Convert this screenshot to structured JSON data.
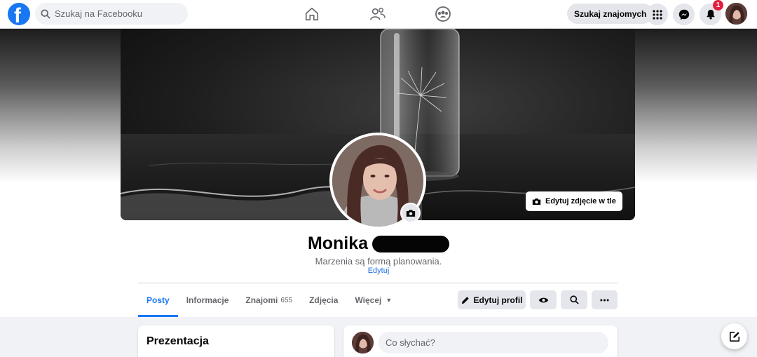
{
  "topbar": {
    "search_placeholder": "Szukaj na Facebooku",
    "find_friends_label": "Szukaj znajomych",
    "notification_count": "1",
    "icons": [
      "facebook-logo",
      "search-icon",
      "home-icon",
      "friends-icon",
      "groups-icon",
      "menu-grid-icon",
      "messenger-icon",
      "bell-icon"
    ]
  },
  "profile": {
    "first_name": "Monika",
    "bio": "Marzenia są formą planowania.",
    "bio_edit_label": "Edytuj",
    "edit_cover_label": "Edytuj zdjęcie w tle"
  },
  "tabs": [
    {
      "label": "Posty",
      "active": true
    },
    {
      "label": "Informacje"
    },
    {
      "label": "Znajomi",
      "count": "655"
    },
    {
      "label": "Zdjęcia"
    },
    {
      "label": "Więcej"
    }
  ],
  "actions": {
    "edit_profile_label": "Edytuj profil"
  },
  "intro": {
    "title": "Prezentacja"
  },
  "composer": {
    "placeholder": "Co słychać?"
  },
  "colors": {
    "brand": "#1877f2",
    "badge": "#e41e3f",
    "link": "#216fdb"
  }
}
